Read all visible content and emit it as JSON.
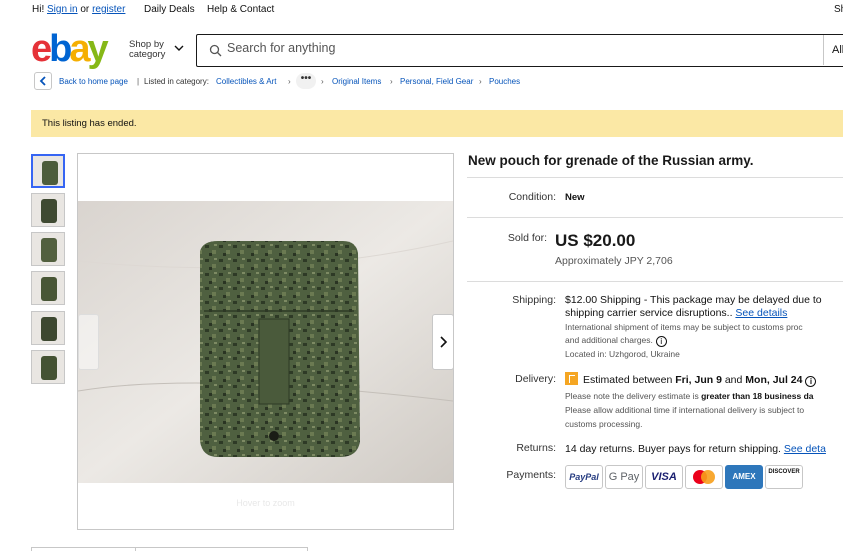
{
  "topbar": {
    "greeting_prefix": "Hi!",
    "sign_in": "Sign in",
    "or": "or",
    "register": "register",
    "daily_deals": "Daily Deals",
    "help": "Help & Contact",
    "ship_to_clip": "Sh"
  },
  "header": {
    "logo": [
      "e",
      "b",
      "a",
      "y"
    ],
    "shop_by_line1": "Shop by",
    "shop_by_line2": "category",
    "search_placeholder": "Search for anything",
    "all_categories_clip": "All"
  },
  "breadcrumb": {
    "back": "Back to home page",
    "divider": "|",
    "listed_in": "Listed in category:",
    "items": [
      "Collectibles & Art",
      "Original Items",
      "Personal, Field Gear",
      "Pouches"
    ],
    "ellipsis": "•••"
  },
  "banner": {
    "text": "This listing has ended."
  },
  "gallery": {
    "thumbnail_count": 6,
    "selected_index": 0,
    "hover_hint": "Hover to zoom"
  },
  "listing": {
    "title": "New pouch for grenade of the Russian army.",
    "condition_label": "Condition:",
    "condition_value": "New",
    "sold_label": "Sold for:",
    "price": "US $20.00",
    "approx_price": "Approximately JPY 2,706",
    "shipping_label": "Shipping:",
    "shipping_line1": "$12.00 Shipping - This package may be delayed due to",
    "shipping_line2": "shipping carrier service disruptions..",
    "shipping_link": "See details",
    "shipping_note1": "International shipment of items may be subject to customs proc",
    "shipping_note2": "and additional charges.",
    "location": "Located in: Uzhgorod, Ukraine",
    "delivery_label": "Delivery:",
    "delivery_text": "Estimated between",
    "delivery_date1": "Fri, Jun 9",
    "delivery_and": "and",
    "delivery_date2": "Mon, Jul 24",
    "delivery_note1_a": "Please note the delivery estimate is",
    "delivery_note1_b": "greater than 18 business da",
    "delivery_note2": "Please allow additional time if international delivery is subject to",
    "delivery_note3": "customs processing.",
    "returns_label": "Returns:",
    "returns_text": "14 day returns. Buyer pays for return shipping.",
    "returns_link": "See deta",
    "payments_label": "Payments:",
    "payments": [
      "PayPal",
      "G Pay",
      "VISA",
      "Mastercard",
      "AMEX",
      "DISCOVER"
    ]
  },
  "colors": {
    "link": "#0654ba",
    "banner_bg": "#fbe8a5",
    "selected_thumb": "#3665f3"
  }
}
